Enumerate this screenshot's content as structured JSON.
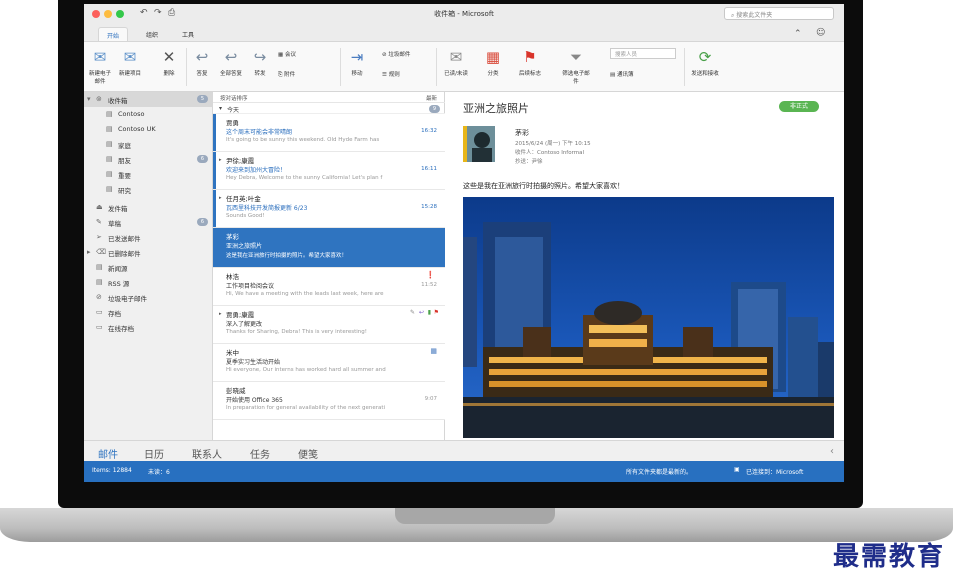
{
  "window": {
    "title": "收件箱 - Microsoft",
    "search_placeholder": "搜索此文件夹"
  },
  "tabs": [
    {
      "label": "开始"
    },
    {
      "label": "组织"
    },
    {
      "label": "工具"
    }
  ],
  "ribbon": {
    "new_email": "新建电子邮件",
    "new_item": "新建项目",
    "delete": "删除",
    "reply": "答复",
    "reply_all": "全部答复",
    "forward": "转发",
    "meeting": "会议",
    "attachment": "附件",
    "move": "移动",
    "junk": "垃圾邮件",
    "rules": "规则",
    "read_unread": "已读/未读",
    "categorize": "分类",
    "follow_up": "后续标志",
    "filter": "筛选电子邮件",
    "search_people_placeholder": "搜索人员",
    "address_book": "通讯簿",
    "send_receive": "发送和接收"
  },
  "folders": {
    "inbox": {
      "label": "收件箱",
      "count": "5"
    },
    "items": [
      {
        "label": "Contoso"
      },
      {
        "label": "Contoso UK"
      },
      {
        "label": "家庭"
      },
      {
        "label": "朋友",
        "count": "6"
      },
      {
        "label": "重要"
      },
      {
        "label": "研究"
      }
    ],
    "others": [
      {
        "label": "发件箱"
      },
      {
        "label": "草稿",
        "count": "6"
      },
      {
        "label": "已发送邮件"
      },
      {
        "label": "已删除邮件"
      },
      {
        "label": "新闻源"
      },
      {
        "label": "RSS 源"
      },
      {
        "label": "垃圾电子邮件"
      },
      {
        "label": "存档"
      },
      {
        "label": "在线存档"
      }
    ]
  },
  "list": {
    "sort_label": "按对话排序",
    "order_label": "最新",
    "group_label": "今天",
    "group_count": "9",
    "messages": [
      {
        "sender": "贾勇",
        "subject": "这个周末可能会非常晴朗",
        "preview": "It's going to be sunny this weekend. Old Hyde Farm has",
        "time": "16:32"
      },
      {
        "sender": "尹徐;康霞",
        "subject": "欢迎来到加州大冒险！",
        "preview": "Hey Debra, Welcome to the sunny California! Let's plan f",
        "time": "16:11"
      },
      {
        "sender": "任月英;叶金",
        "subject": "瓦西里科技开发简报更新 6/23",
        "preview": "Sounds Good!",
        "time": "15:28"
      },
      {
        "sender": "茅彩",
        "subject": "亚洲之旅照片",
        "preview": "这是我在亚洲旅行时拍摄的照片。希望大家喜欢！",
        "time": ""
      },
      {
        "sender": "林浩",
        "subject": "工作项目检阅会议",
        "preview": "Hi, We have a meeting with the leads last week, here are",
        "time": "11:52"
      },
      {
        "sender": "贾勇;康霞",
        "subject": "深入了解更改",
        "preview": "Thanks for Sharing, Debra! This is very interesting!",
        "time": ""
      },
      {
        "sender": "米中",
        "subject": "夏季实习生活动开始",
        "preview": "Hi everyone, Our interns has worked hard all summer and",
        "time": ""
      },
      {
        "sender": "彭晓威",
        "subject": "开始使用 Office 365",
        "preview": "In preparation for general availability of the next generati",
        "time": "9:07"
      }
    ]
  },
  "reading": {
    "subject": "亚洲之旅照片",
    "tag": "非正式",
    "sender": "茅彩",
    "date": "2015/6/24 (周一) 下午 10:15",
    "to": "收件人：Contoso Informal",
    "cc": "抄送：尹徐",
    "body": "这些是我在亚洲旅行时拍摄的照片。希望大家喜欢！"
  },
  "nav": [
    {
      "label": "邮件"
    },
    {
      "label": "日历"
    },
    {
      "label": "联系人"
    },
    {
      "label": "任务"
    },
    {
      "label": "便笺"
    }
  ],
  "status": {
    "items": "Items: 12884",
    "unread": "未读：6",
    "sync": "所有文件夹都是最新的。",
    "connected": "已连接到：Microsoft"
  },
  "watermark": "最需教育",
  "colors": {
    "accent": "#2f74c0",
    "status_bar": "#2870c0",
    "tag": "#5ab552"
  }
}
